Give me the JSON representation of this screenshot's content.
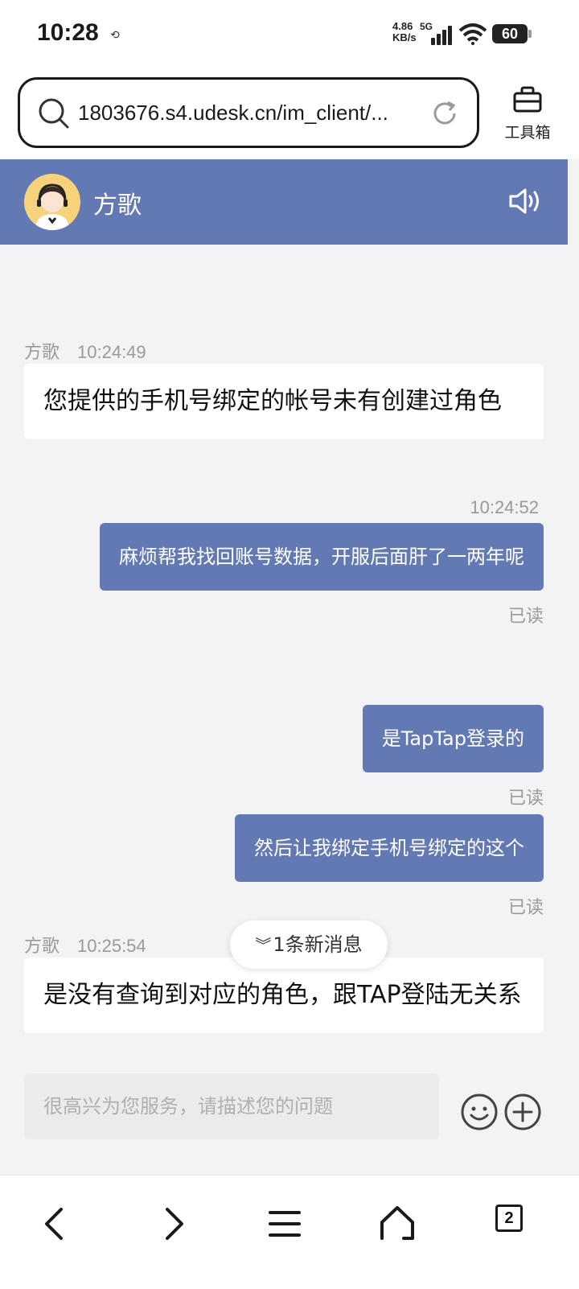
{
  "status_bar": {
    "time": "10:28",
    "net_speed_value": "4.86",
    "net_speed_unit": "KB/s",
    "network_type": "5G",
    "battery": "60",
    "icons": [
      "sync-icon",
      "signal-icon",
      "wifi-icon",
      "battery-icon"
    ]
  },
  "browser": {
    "url": "1803676.s4.udesk.cn/im_client/...",
    "toolbox_label": "工具箱"
  },
  "chat_header": {
    "agent_name": "方歌",
    "accent_color": "#6379b4"
  },
  "messages": [
    {
      "direction": "in",
      "sender": "方歌",
      "time": "10:24:49",
      "text": "您提供的手机号绑定的帐号未有创建过角色"
    },
    {
      "direction": "out",
      "time": "10:24:52",
      "text": "麻烦帮我找回账号数据，开服后面肝了一两年呢",
      "status": "已读"
    },
    {
      "direction": "out",
      "text": "是TapTap登录的",
      "status": "已读"
    },
    {
      "direction": "out",
      "text": "然后让我绑定手机号绑定的这个",
      "status": "已读"
    },
    {
      "direction": "in",
      "sender": "方歌",
      "time": "10:25:54",
      "text": "是没有查询到对应的角色，跟TAP登陆无关系"
    }
  ],
  "new_message_indicator": "1条新消息",
  "input": {
    "placeholder": "很高兴为您服务，请描述您的问题"
  },
  "bottom_nav": {
    "tabs_count": "2"
  }
}
